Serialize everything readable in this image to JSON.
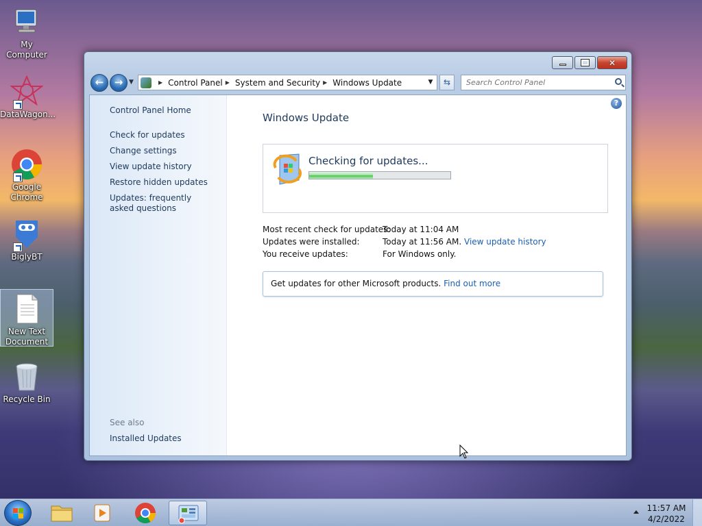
{
  "desktop": {
    "icons": [
      {
        "label": "My Computer"
      },
      {
        "label": "DataWagon..."
      },
      {
        "label": "Google Chrome"
      },
      {
        "label": "BiglyBT"
      },
      {
        "label": "New Text Document"
      },
      {
        "label": "Recycle Bin"
      }
    ]
  },
  "window": {
    "address": {
      "crumbs": [
        "Control Panel",
        "System and Security",
        "Windows Update"
      ]
    },
    "search": {
      "placeholder": "Search Control Panel"
    },
    "left_pane": {
      "home": "Control Panel Home",
      "links": [
        "Check for updates",
        "Change settings",
        "View update history",
        "Restore hidden updates",
        "Updates: frequently asked questions"
      ],
      "see_also_heading": "See also",
      "see_also_links": [
        "Installed Updates"
      ]
    },
    "main": {
      "title": "Windows Update",
      "status_text": "Checking for updates...",
      "progress_fraction": 0.45,
      "info": [
        {
          "label": "Most recent check for updates:",
          "value": "Today at 11:04 AM",
          "link": ""
        },
        {
          "label": "Updates were installed:",
          "value": "Today at 11:56 AM.",
          "link": "View update history"
        },
        {
          "label": "You receive updates:",
          "value": "For Windows only.",
          "link": ""
        }
      ],
      "promo": {
        "text": "Get updates for other Microsoft products.",
        "link": "Find out more"
      }
    }
  },
  "taskbar": {
    "clock_time": "11:57 AM",
    "clock_date": "4/2/2022"
  },
  "colors": {
    "link": "#1a5fb4",
    "title_text": "#1e395b",
    "progress_green": "#4ec24e"
  }
}
